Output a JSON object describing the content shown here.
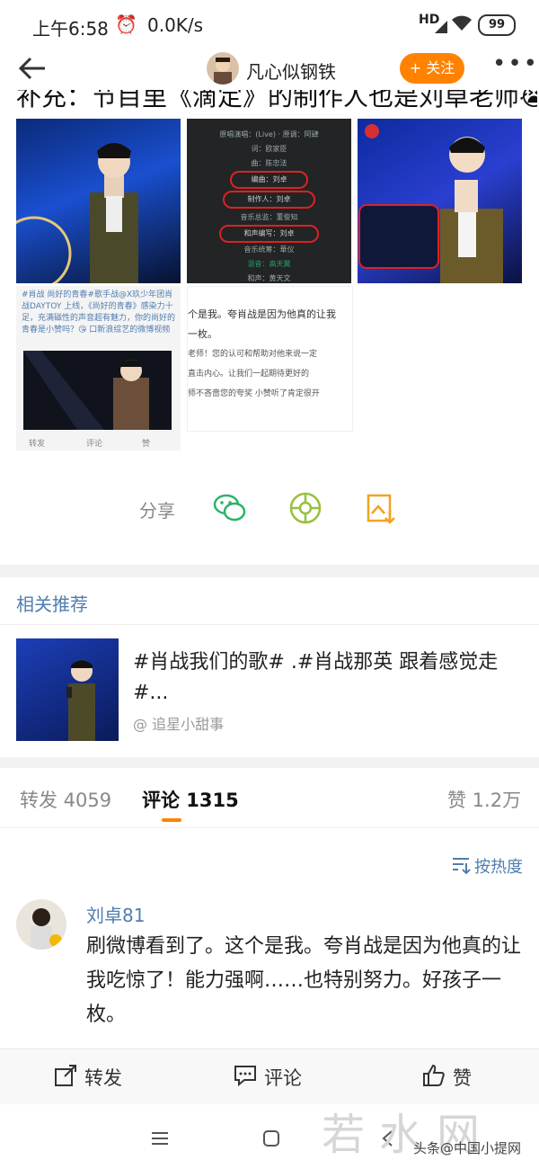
{
  "status_bar": {
    "time": "上午6:58",
    "speed": "0.0K/s",
    "hd": "HD",
    "battery": "99"
  },
  "header": {
    "username": "凡心似钢铁",
    "follow_label": "+ 关注"
  },
  "post": {
    "truncated_text": "补充：节目里《滴定》的制作人也是刘卓老师😭",
    "img1_caption": "#肖战 尚好的青春#歌手战@X玖少年团肖战DAYTOY 上线，《尚好的青春》感染力十足，充满磁性的声音超有魅力，你的尚好的青春是小赞吗？😘 口新浪综艺的微博视频",
    "img1_actions": [
      "转发",
      "评论",
      "赞"
    ],
    "img2_credits": [
      "原唱演唱：(Live) · 原调：阿肆",
      "词：欧家臣",
      "曲：陈忠法",
      "编曲：刘卓",
      "制作人：刘卓",
      "音乐总监：董俊知",
      "和声编写：刘卓",
      "音乐统筹：華仪",
      "混音：高天翼",
      "和声：黄天文"
    ],
    "img2_comment": [
      "个是我。夸肖战是因为他真的让我",
      "一枚。",
      "老师！您的认可和帮助对他来说一定",
      "直击内心。让我们一起期待更好的",
      "师不吝啬您的夸奖 小赞听了肯定很开"
    ]
  },
  "share": {
    "label": "分享"
  },
  "related": {
    "title": "相关推荐",
    "text": "#肖战我们的歌# .#肖战那英 跟着感觉走#...",
    "source": "@ 追星小甜事"
  },
  "tabs": {
    "repost": "转发 4059",
    "comment": "评论 1315",
    "like": "赞 1.2万"
  },
  "sort_label": "按热度",
  "comment": {
    "name": "刘卓81",
    "text": "刷微博看到了。这个是我。夸肖战是因为他真的让我吃惊了！能力强啊……也特别努力。好孩子一枚。"
  },
  "action_bar": {
    "repost": "转发",
    "comment": "评论",
    "like": "赞"
  },
  "watermark": {
    "big": "若水网",
    "small": "头条@中国小提网"
  }
}
